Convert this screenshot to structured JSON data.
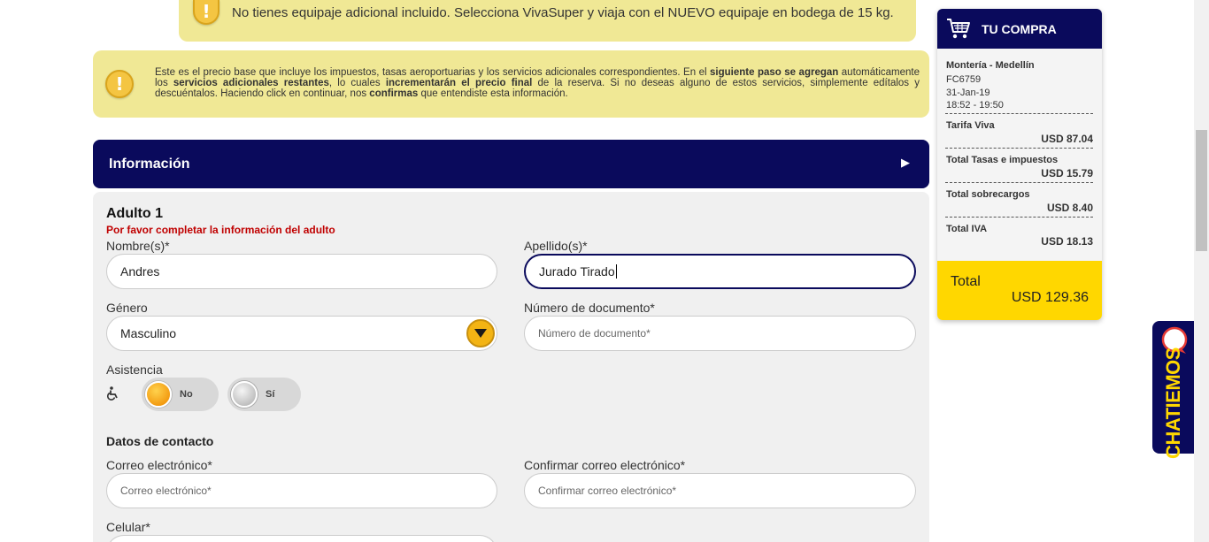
{
  "notices": {
    "top_text": "No tienes equipaje adicional incluido. Selecciona VivaSuper y viaja con el NUEVO equipaje en bodega de 15 kg.",
    "main": {
      "t1": "Este es el precio base que incluye los impuestos, tasas aeroportuarias y los servicios adicionales correspondientes. En el ",
      "b1": "siguiente paso se agregan",
      "t2": " automáticamente los ",
      "b2": "servicios adicionales restantes",
      "t3": ", lo cuales ",
      "b3": "incrementarán el precio final",
      "t4": " de la reserva. Si no deseas alguno de estos servicios, simplemente edítalos y descuéntalos. Haciendo click en continuar, nos ",
      "b4": "confirmas",
      "t5": " que entendiste esta información."
    }
  },
  "info_bar": {
    "title": "Información",
    "arrow": "▶"
  },
  "form": {
    "adult_title": "Adulto 1",
    "error_msg": "Por favor completar la información del adulto",
    "first_name": {
      "label": "Nombre(s)*",
      "value": "Andres"
    },
    "last_name": {
      "label": "Apellido(s)*",
      "value": "Jurado Tirado"
    },
    "gender": {
      "label": "Género",
      "value": "Masculino"
    },
    "document": {
      "label": "Número de documento*",
      "placeholder": "Número de documento*"
    },
    "assistance": {
      "label": "Asistencia",
      "no": "No",
      "yes": "Sí"
    },
    "contact_title": "Datos de contacto",
    "email": {
      "label": "Correo electrónico*",
      "placeholder": "Correo electrónico*"
    },
    "email_confirm": {
      "label": "Confirmar correo electrónico*",
      "placeholder": "Confirmar correo electrónico*"
    },
    "phone": {
      "label": "Celular*"
    }
  },
  "cart": {
    "title": "TU COMPRA",
    "route": "Montería - Medellín",
    "flight": "FC6759",
    "date": "31-Jan-19",
    "time": "18:52 - 19:50",
    "rows": [
      {
        "label": "Tarifa Viva",
        "value": "USD 87.04"
      },
      {
        "label": "Total Tasas e impuestos",
        "value": "USD 15.79"
      },
      {
        "label": "Total sobrecargos",
        "value": "USD 8.40"
      },
      {
        "label": "Total IVA",
        "value": "USD 18.13"
      }
    ],
    "total_label": "Total",
    "total_value": "USD 129.36"
  },
  "chat": {
    "label": "CHATIEMOS"
  }
}
